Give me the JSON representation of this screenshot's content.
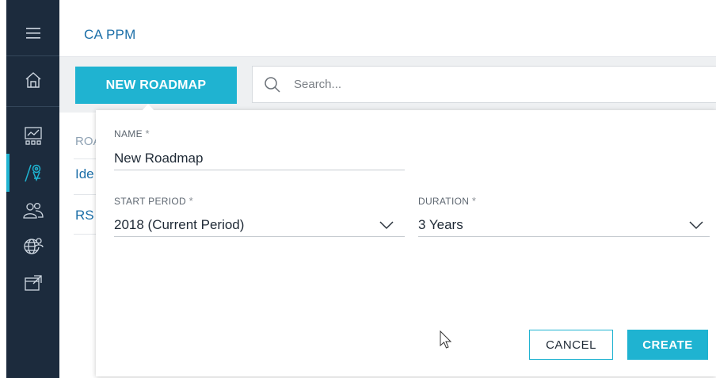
{
  "app": {
    "title": "CA PPM"
  },
  "toolbar": {
    "new_button_label": "NEW ROADMAP",
    "search_placeholder": "Search..."
  },
  "sidebar": {
    "items": [
      {
        "name": "menu",
        "icon": "hamburger-menu-icon",
        "active": false
      },
      {
        "name": "home",
        "icon": "home-icon",
        "active": false
      },
      {
        "name": "dashboards",
        "icon": "chart-board-icon",
        "active": false
      },
      {
        "name": "roadmaps",
        "icon": "roadmap-pin-icon",
        "active": true
      },
      {
        "name": "resources",
        "icon": "people-icon",
        "active": false
      },
      {
        "name": "global",
        "icon": "globe-person-icon",
        "active": false
      },
      {
        "name": "launch",
        "icon": "open-external-icon",
        "active": false
      }
    ],
    "accent_color": "#1fb3d1",
    "background_color": "#1c2b3d"
  },
  "background_list": {
    "header_partial": "ROA",
    "rows": [
      "Ide",
      "RS"
    ]
  },
  "modal": {
    "name": {
      "label": "NAME",
      "value": "New Roadmap"
    },
    "start_period": {
      "label": "START PERIOD",
      "value": "2018 (Current Period)"
    },
    "duration": {
      "label": "DURATION",
      "value": "3 Years"
    },
    "required_marker": "*",
    "cancel_label": "CANCEL",
    "create_label": "CREATE"
  }
}
